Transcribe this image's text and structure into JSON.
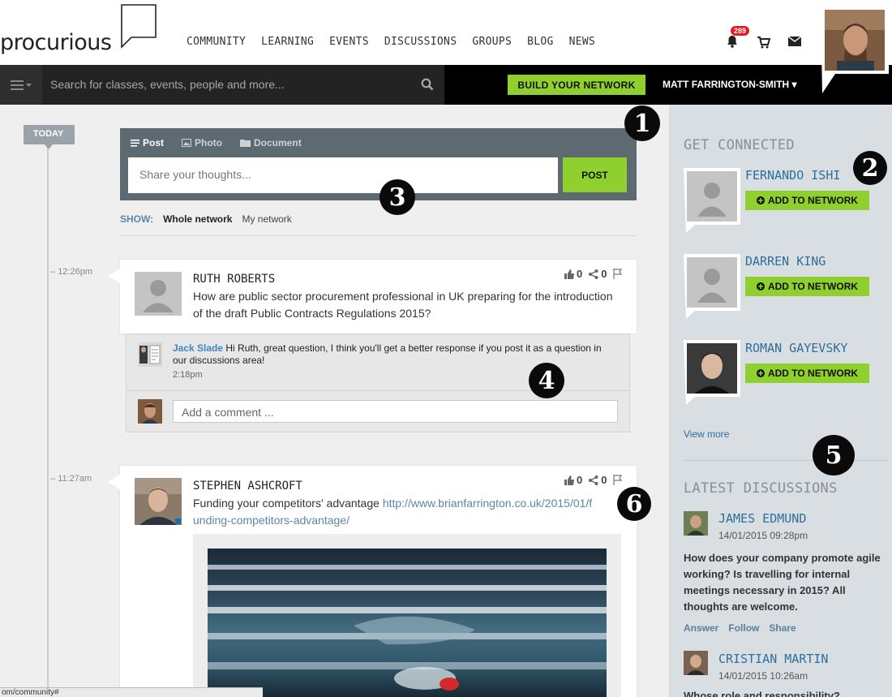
{
  "brand": {
    "logo": "procurious"
  },
  "nav": {
    "items": [
      "COMMUNITY",
      "LEARNING",
      "EVENTS",
      "DISCUSSIONS",
      "GROUPS",
      "BLOG",
      "NEWS"
    ]
  },
  "header": {
    "notifications_count": "289",
    "search_placeholder": "Search for classes, events, people and more...",
    "build_network": "BUILD YOUR NETWORK",
    "user_name": "MATT FARRINGTON-SMITH ▾"
  },
  "timeline": {
    "today": "TODAY"
  },
  "composer": {
    "tabs": [
      "Post",
      "Photo",
      "Document"
    ],
    "placeholder": "Share your thoughts...",
    "post_button": "POST"
  },
  "filter": {
    "label": "SHOW:",
    "options": [
      "Whole network",
      "My network"
    ]
  },
  "posts": [
    {
      "time": "12:26pm",
      "author": "RUTH ROBERTS",
      "text": "How are public sector procurement professional in UK preparing for the introduction of the draft Public Contracts Regulations 2015?",
      "likes": "0",
      "shares": "0",
      "comment": {
        "author": "Jack Slade",
        "text": "Hi Ruth, great question, I think you'll get a better response if you post it as a question in our discussions area!",
        "time": "2:18pm"
      },
      "add_comment_placeholder": "Add a comment ..."
    },
    {
      "time": "11:27am",
      "author": "STEPHEN ASHCROFT",
      "text": "Funding your competitors' advantage",
      "link_part1": "http://www.brianfarrington.co.uk/2015/01/f",
      "link_part2": "unding-competitors-advantage/",
      "likes": "0",
      "shares": "0"
    }
  ],
  "sidebar": {
    "get_connected_title": "GET CONNECTED",
    "people": [
      {
        "name": "FERNANDO ISHI",
        "button": "ADD TO NETWORK"
      },
      {
        "name": "DARREN KING",
        "button": "ADD TO NETWORK"
      },
      {
        "name": "ROMAN GAYEVSKY",
        "button": "ADD TO NETWORK"
      }
    ],
    "view_more": "View more",
    "latest_title": "LATEST DISCUSSIONS",
    "discussions": [
      {
        "name": "JAMES EDMUND",
        "date": "14/01/2015 09:28pm",
        "question": "How does your company promote agile working? Is travelling for internal meetings necessary in 2015? All thoughts are welcome.",
        "actions": [
          "Answer",
          "Follow",
          "Share"
        ]
      },
      {
        "name": "CRISTIAN MARTIN",
        "date": "14/01/2015 10:26am",
        "question_partial": "Whose role and responsibility?"
      }
    ]
  },
  "markers": [
    "1",
    "2",
    "3",
    "4",
    "5",
    "6"
  ],
  "status_url": "om/community#",
  "colors": {
    "accent_green": "#8fd02e",
    "link_blue": "#2e6f9a",
    "bar_black": "#000000",
    "badge_red": "#e21b22"
  }
}
